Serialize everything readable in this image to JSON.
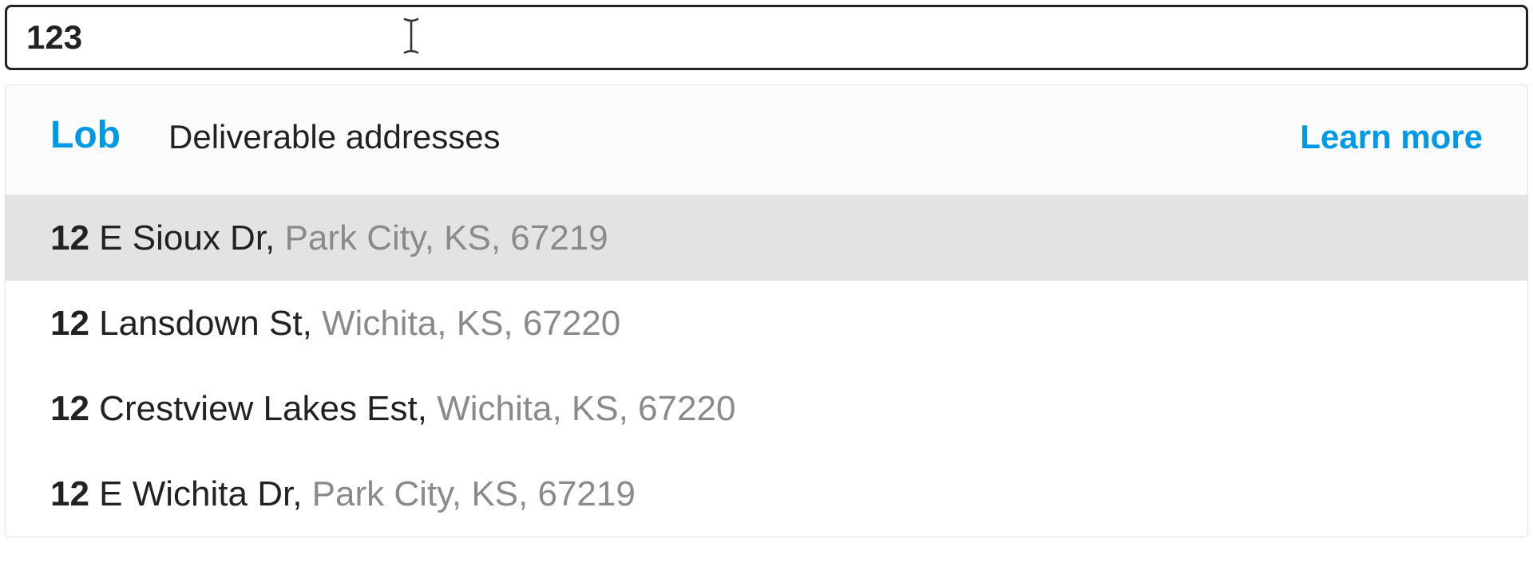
{
  "input": {
    "value": "123"
  },
  "header": {
    "logo_text": "Lob",
    "label": "Deliverable addresses",
    "learn_more": "Learn more"
  },
  "suggestions": [
    {
      "prefix": "12",
      "street": " E Sioux Dr, ",
      "rest": "Park City, KS, 67219",
      "highlighted": true
    },
    {
      "prefix": "12",
      "street": " Lansdown St, ",
      "rest": "Wichita, KS, 67220",
      "highlighted": false
    },
    {
      "prefix": "12",
      "street": " Crestview Lakes Est, ",
      "rest": "Wichita, KS, 67220",
      "highlighted": false
    },
    {
      "prefix": "12",
      "street": " E Wichita Dr, ",
      "rest": "Park City, KS, 67219",
      "highlighted": false
    }
  ],
  "colors": {
    "brand_blue": "#0099e5",
    "text_primary": "#222222",
    "text_muted": "#8a8a8a",
    "highlight_bg": "#e3e3e3"
  }
}
